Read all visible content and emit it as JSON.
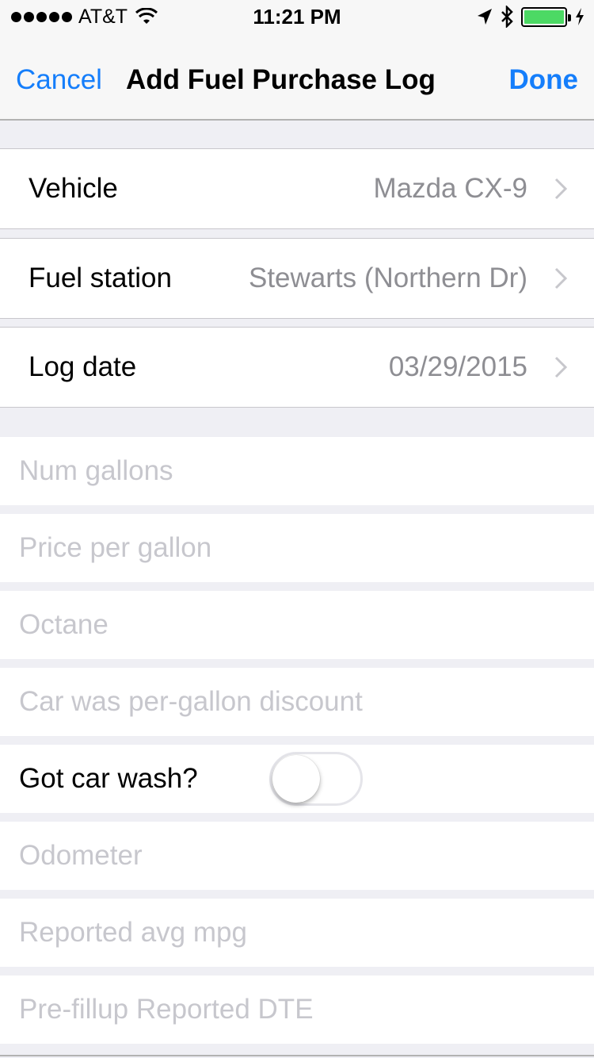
{
  "status_bar": {
    "carrier": "AT&T",
    "time": "11:21 PM",
    "battery_level": 1.0,
    "battery_color": "#4cd964",
    "icons": [
      "signal-dots-icon",
      "wifi-icon",
      "location-arrow-icon",
      "bluetooth-icon",
      "battery-icon",
      "charging-bolt-icon"
    ]
  },
  "nav": {
    "cancel_label": "Cancel",
    "title": "Add Fuel Purchase Log",
    "done_label": "Done",
    "accent_color": "#157efb"
  },
  "selection_rows": [
    {
      "label": "Vehicle",
      "value": "Mazda CX-9"
    },
    {
      "label": "Fuel station",
      "value": "Stewarts (Northern Dr)"
    },
    {
      "label": "Log date",
      "value": "03/29/2015"
    }
  ],
  "input_fields": [
    {
      "placeholder": "Num gallons",
      "value": ""
    },
    {
      "placeholder": "Price per gallon",
      "value": ""
    },
    {
      "placeholder": "Octane",
      "value": ""
    },
    {
      "placeholder": "Car was per-gallon discount",
      "value": ""
    }
  ],
  "car_wash": {
    "label": "Got car wash?",
    "on": false
  },
  "input_fields_2": [
    {
      "placeholder": "Odometer",
      "value": ""
    },
    {
      "placeholder": "Reported avg mpg",
      "value": ""
    },
    {
      "placeholder": "Pre-fillup Reported DTE",
      "value": ""
    }
  ]
}
